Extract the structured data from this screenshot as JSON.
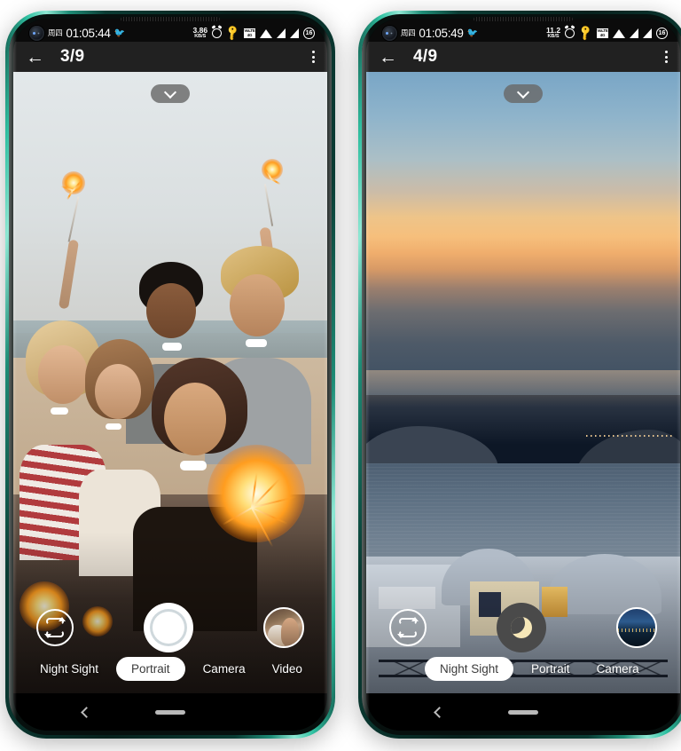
{
  "phones": [
    {
      "id": "phone-left",
      "status_bar": {
        "day": "周四",
        "time": "01:05:44",
        "net_speed_value": "3.86",
        "net_speed_unit": "KB/S",
        "volte_label_top": "VoLTE",
        "volte_label_bottom": "4G",
        "battery_level": "16",
        "icons": [
          "camera-hole",
          "bird-icon",
          "alarm-icon",
          "key-icon",
          "volte-icon",
          "wifi-icon",
          "signal-icon",
          "signal-icon",
          "battery-icon"
        ]
      },
      "app_bar": {
        "back_label": "←",
        "title": "3/9",
        "overflow_label": "more-options"
      },
      "viewfinder": {
        "scene": "friends-with-sparklers-beach",
        "expand_chevron": "chevron-down-icon"
      },
      "controls": {
        "flip_camera_label": "flip-camera",
        "shutter_label": "shutter",
        "shutter_style": "photo",
        "thumbnail_label": "last-photo-thumbnail"
      },
      "modes": [
        {
          "label": "Night Sight",
          "active": false
        },
        {
          "label": "Portrait",
          "active": true
        },
        {
          "label": "Camera",
          "active": false
        },
        {
          "label": "Video",
          "active": false
        }
      ],
      "nav_bar": {
        "back_label": "back",
        "home_label": "home-indicator"
      }
    },
    {
      "id": "phone-right",
      "status_bar": {
        "day": "周四",
        "time": "01:05:49",
        "net_speed_value": "11.2",
        "net_speed_unit": "KB/S",
        "volte_label_top": "VoLTE",
        "volte_label_bottom": "4G",
        "battery_level": "16",
        "icons": [
          "camera-hole",
          "bird-icon",
          "alarm-icon",
          "key-icon",
          "volte-icon",
          "wifi-icon",
          "signal-icon",
          "signal-icon",
          "battery-icon"
        ]
      },
      "app_bar": {
        "back_label": "←",
        "title": "4/9",
        "overflow_label": "more-options"
      },
      "viewfinder": {
        "scene": "santorini-sunset-seascape",
        "expand_chevron": "chevron-down-icon"
      },
      "controls": {
        "flip_camera_label": "flip-camera",
        "shutter_label": "shutter",
        "shutter_style": "night",
        "thumbnail_label": "last-photo-thumbnail"
      },
      "modes": [
        {
          "label": "Night Sight",
          "active": true
        },
        {
          "label": "Portrait",
          "active": false
        },
        {
          "label": "Camera",
          "active": false
        }
      ],
      "nav_bar": {
        "back_label": "back",
        "home_label": "home-indicator"
      }
    }
  ],
  "colors": {
    "frame_teal": "#2fbfa0",
    "status_bar_bg": "#0b0b0b",
    "app_bar_bg": "#212121",
    "active_mode_bg": "#ffffff",
    "active_mode_text": "#3b3b3b",
    "night_shutter_bg": "#4a4a4a",
    "moon_color": "#f6e7b8",
    "page_bg": "#ffffff"
  }
}
